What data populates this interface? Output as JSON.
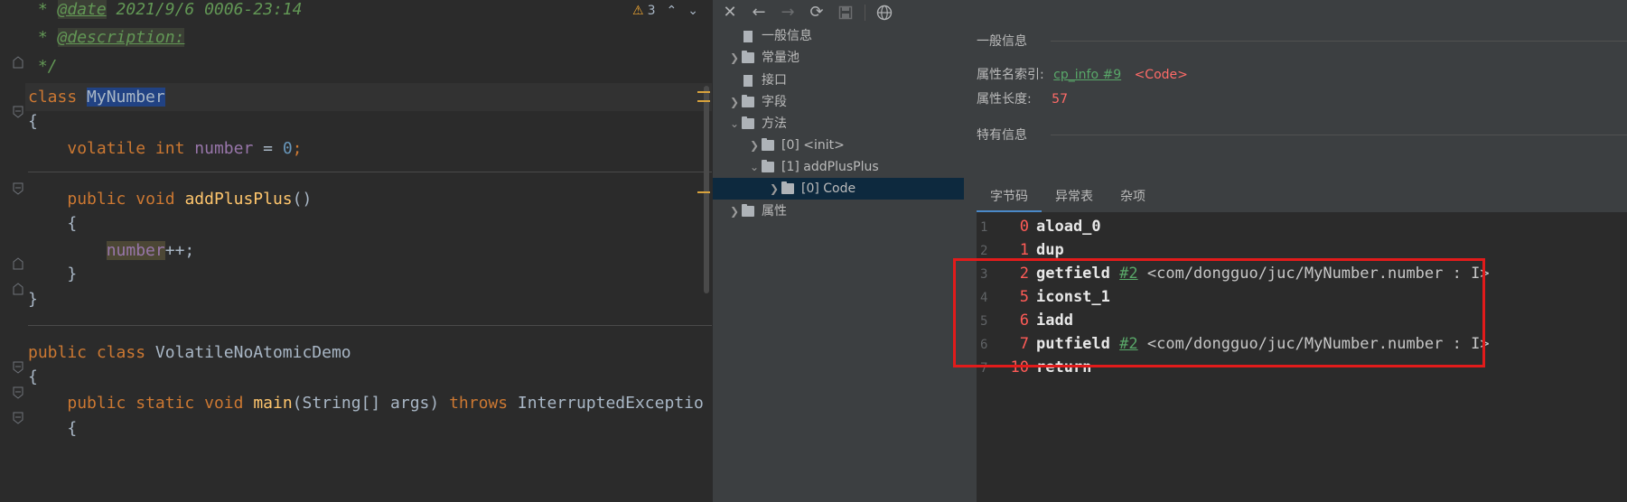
{
  "editor": {
    "doc_comment": {
      "date_tag": "@date",
      "date_value": "2021/9/6 0006-23:14",
      "description_tag": "@description:",
      "end": "*/"
    },
    "warnings": {
      "count": "3"
    },
    "code": {
      "l4_kw": "class",
      "l4_name": "MyNumber",
      "l5": "{",
      "l6_mod": "volatile",
      "l6_type": "int",
      "l6_field": "number",
      "l6_eq": " = ",
      "l6_val": "0",
      "l6_semi": ";",
      "l8_mod": "public",
      "l8_type": "void",
      "l8_fn": "addPlusPlus",
      "l8_paren": "()",
      "l9": "{",
      "l10_field": "number",
      "l10_rest": "++;",
      "l11": "}",
      "l12": "}",
      "l14_mod": "public",
      "l14_kw": "class",
      "l14_name": "VolatileNoAtomicDemo",
      "l15": "{",
      "l16_mod": "public",
      "l16_static": "static",
      "l16_type": "void",
      "l16_fn": "main",
      "l16_args": "(String[] args) ",
      "l16_throws": "throws",
      "l16_exc": " InterruptedExceptio",
      "l17": "{"
    }
  },
  "toolbar": {
    "icons": [
      "close-icon",
      "back-icon",
      "forward-icon",
      "refresh-icon",
      "save-icon",
      "web-icon"
    ]
  },
  "tree": {
    "general": "一般信息",
    "constant_pool": "常量池",
    "interfaces": "接口",
    "fields": "字段",
    "methods": "方法",
    "init": "[0] <init>",
    "addplusplus": "[1] addPlusPlus",
    "code": "[0] Code",
    "attributes": "属性"
  },
  "detail": {
    "general_title": "一般信息",
    "name_index_label": "属性名索引:",
    "name_index_link": "cp_info #9",
    "name_index_value": "<Code>",
    "length_label": "属性长度:",
    "length_value": "57",
    "specific_title": "特有信息",
    "tabs": [
      "字节码",
      "异常表",
      "杂项"
    ]
  },
  "bytecode": [
    {
      "line": "1",
      "offset": "0",
      "op": "aload_0",
      "ref": "",
      "comment": ""
    },
    {
      "line": "2",
      "offset": "1",
      "op": "dup",
      "ref": "",
      "comment": ""
    },
    {
      "line": "3",
      "offset": "2",
      "op": "getfield",
      "ref": "#2",
      "comment": "<com/dongguo/juc/MyNumber.number : I>"
    },
    {
      "line": "4",
      "offset": "5",
      "op": "iconst_1",
      "ref": "",
      "comment": ""
    },
    {
      "line": "5",
      "offset": "6",
      "op": "iadd",
      "ref": "",
      "comment": ""
    },
    {
      "line": "6",
      "offset": "7",
      "op": "putfield",
      "ref": "#2",
      "comment": "<com/dongguo/juc/MyNumber.number : I>"
    },
    {
      "line": "7",
      "offset": "10",
      "op": "return",
      "ref": "",
      "comment": ""
    }
  ],
  "colors": {
    "highlight_box": "#e21b1b",
    "selected_tree_row": "#0d293e",
    "accent_tab": "#4a88c7"
  }
}
